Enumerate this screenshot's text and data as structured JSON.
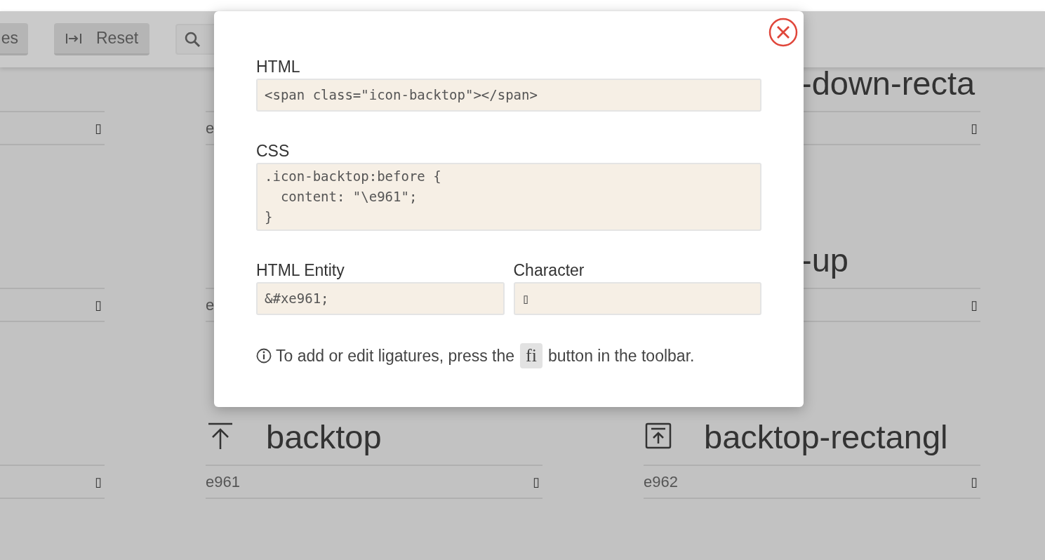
{
  "toolbar": {
    "buttons": [
      {
        "label": "es",
        "kind": "plain"
      },
      {
        "label": "Reset",
        "kind": "reset"
      }
    ]
  },
  "cards": [
    {
      "kind": "full",
      "glyph": "▯"
    },
    {
      "kind": "full",
      "code": "e"
    },
    {
      "kind": "cut",
      "name": "-down-recta",
      "glyph": "▯"
    },
    {
      "kind": "full",
      "glyph": "▯"
    },
    {
      "kind": "full",
      "code": "e"
    },
    {
      "kind": "cut",
      "name": "-up",
      "glyph": "▯"
    },
    {
      "kind": "full",
      "glyph": "▯"
    },
    {
      "kind": "arrow-up-bar",
      "name": "backtop",
      "code": "e961",
      "glyph": "▯"
    },
    {
      "kind": "arrow-up-box",
      "name": "backtop-rectangl",
      "code": "e962",
      "glyph": "▯"
    }
  ],
  "dialog": {
    "html_label": "HTML",
    "html_code": "<span class=\"icon-backtop\"></span>",
    "css_label": "CSS",
    "css_code": ".icon-backtop:before {\n  content: \"\\e961\";\n}",
    "entity_label": "HTML Entity",
    "entity_value": "&#xe961;",
    "character_label": "Character",
    "character_value": "▯",
    "info_before": "To add or edit ligatures, press the",
    "info_key": "fi",
    "info_after": "button in the toolbar."
  }
}
